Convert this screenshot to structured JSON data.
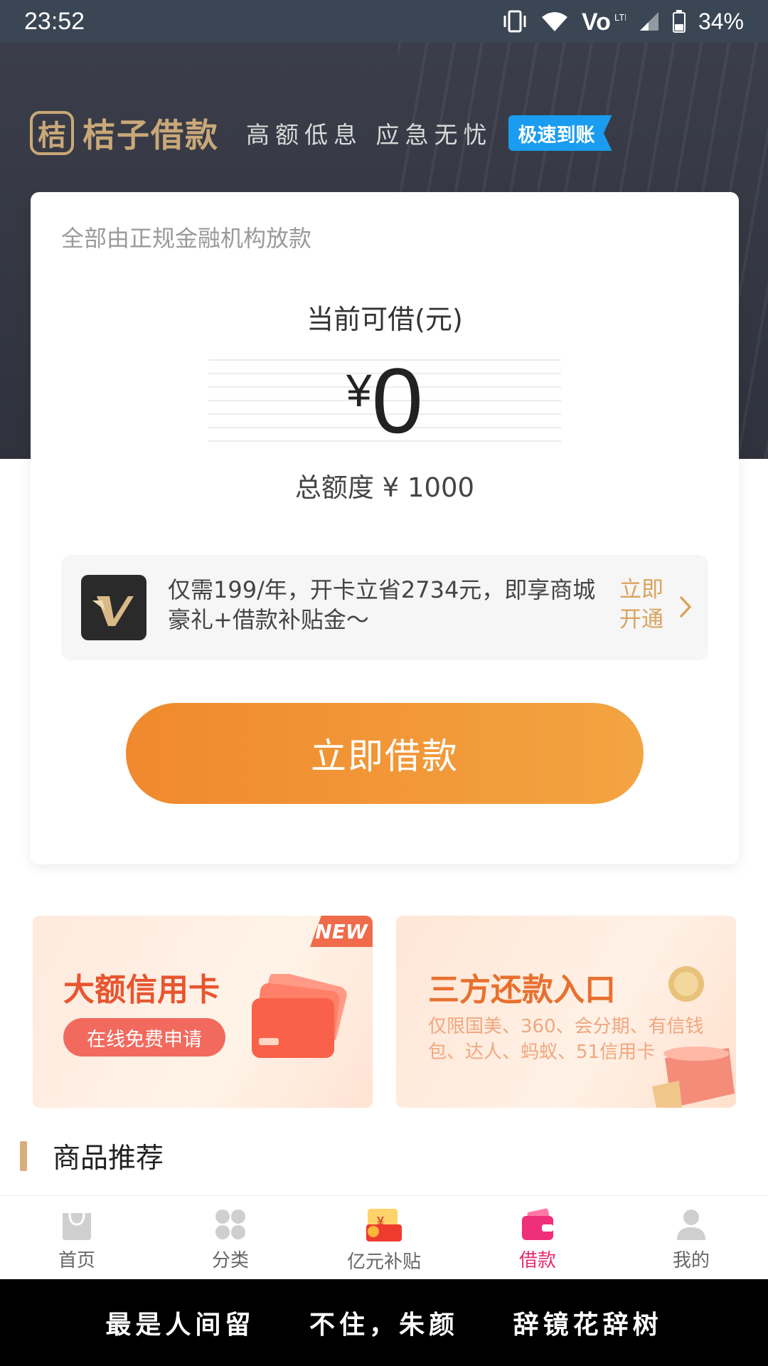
{
  "status_bar": {
    "time": "23:52",
    "battery": "34%"
  },
  "header": {
    "logo_char": "桔",
    "brand": "桔子借款",
    "slogan": "高额低息 应急无忧",
    "badge": "极速到账"
  },
  "card": {
    "note": "全部由正规金融机构放款",
    "available_label": "当前可借(元)",
    "currency": "¥",
    "available_amount": "0",
    "total_line": "总额度 ¥ 1000",
    "vip": {
      "text": "仅需199/年，开卡立省2734元，即享商城豪礼+借款补贴金～",
      "action": "立即开通"
    },
    "borrow_button": "立即借款"
  },
  "banners": {
    "left": {
      "tag": "NEW",
      "title": "大额信用卡",
      "button": "在线免费申请"
    },
    "right": {
      "title": "三方还款入口",
      "subtitle": "仅限国美、360、会分期、有信钱包、达人、蚂蚁、51信用卡"
    }
  },
  "section": {
    "title": "商品推荐"
  },
  "tabs": [
    {
      "label": "首页",
      "icon": "home-bag-icon"
    },
    {
      "label": "分类",
      "icon": "category-grid-icon"
    },
    {
      "label": "亿元补贴",
      "icon": "subsidy-envelope-icon"
    },
    {
      "label": "借款",
      "icon": "wallet-icon",
      "active": true
    },
    {
      "label": "我的",
      "icon": "user-icon"
    }
  ],
  "lyrics": [
    "最是人间留",
    "不住，朱颜",
    "辞镜花辞树"
  ],
  "colors": {
    "accent": "#f0892d",
    "active_tab": "#e8286e",
    "gold": "#c9a878",
    "badge_blue": "#1a9cf0"
  }
}
